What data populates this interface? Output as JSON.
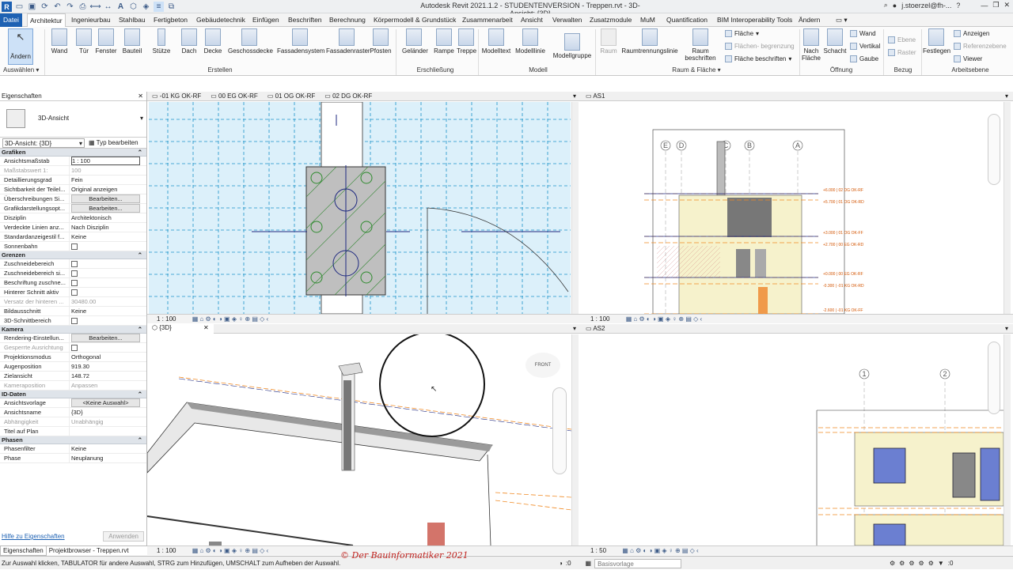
{
  "titlebar": {
    "title": "Autodesk Revit 2021.1.2 - STUDENTENVERSION - Treppen.rvt - 3D-Ansicht: {3D}",
    "user": "j.stoerzel@fh-..."
  },
  "menu": {
    "tabs": [
      "Datei",
      "Architektur",
      "Ingenieurbau",
      "Stahlbau",
      "Fertigbeton",
      "Gebäudetechnik",
      "Einfügen",
      "Beschriften",
      "Berechnung",
      "Körpermodell & Grundstück",
      "Zusammenarbeit",
      "Ansicht",
      "Verwalten",
      "Zusatzmodule",
      "MuM",
      "Quantification",
      "BIM Interoperability Tools",
      "Ändern"
    ]
  },
  "ribbon": {
    "modify": "Ändern",
    "select": "Auswählen",
    "build": [
      "Wand",
      "Tür",
      "Fenster",
      "Bauteil",
      "Stütze",
      "Dach",
      "Decke",
      "Geschossdecke",
      "Fassadensystem",
      "Fassadenraster",
      "Pfosten"
    ],
    "build_panel": "Erstellen",
    "circulation": [
      "Geländer",
      "Rampe",
      "Treppe"
    ],
    "circulation_panel": "Erschließung",
    "model": [
      "Modelltext",
      "Modelllinie",
      "Modellgruppe"
    ],
    "model_panel": "Modell",
    "room": [
      "Raum",
      "Raumtrennungslinie",
      "Raum beschriften"
    ],
    "area_small": [
      "Fläche",
      "Flächen- begrenzung",
      "Fläche beschriften"
    ],
    "room_panel": "Raum & Fläche",
    "opening": [
      "Nach Fläche",
      "Schacht"
    ],
    "opening_small": [
      "Wand",
      "Vertikal",
      "Gaube"
    ],
    "opening_panel": "Öffnung",
    "datum_small": [
      "Ebene",
      "Raster"
    ],
    "datum_panel": "Bezug",
    "workplane": "Festlegen",
    "workplane_small": [
      "Anzeigen",
      "Referenzebene",
      "Viewer"
    ],
    "workplane_panel": "Arbeitsebene"
  },
  "properties": {
    "header": "Eigenschaften",
    "type_name": "3D-Ansicht",
    "instance": "3D-Ansicht: {3D}",
    "edit_type": "Typ bearbeiten",
    "groups": [
      {
        "name": "Grafiken",
        "rows": [
          [
            "Ansichtsmaßstab",
            "1 : 100"
          ],
          [
            "Maßstabswert 1:",
            "100"
          ],
          [
            "Detaillierungsgrad",
            "Fein"
          ],
          [
            "Sichtbarkeit der Teilel...",
            "Original anzeigen"
          ],
          [
            "Überschreibungen Si...",
            "Bearbeiten..."
          ],
          [
            "Grafikdarstellungsopt...",
            "Bearbeiten..."
          ],
          [
            "Disziplin",
            "Architektonisch"
          ],
          [
            "Verdeckte Linien anz...",
            "Nach Disziplin"
          ],
          [
            "Standardanzeigestil f...",
            "Keine"
          ],
          [
            "Sonnenbahn",
            ""
          ]
        ]
      },
      {
        "name": "Grenzen",
        "rows": [
          [
            "Zuschneidebereich",
            ""
          ],
          [
            "Zuschneidebereich si...",
            ""
          ],
          [
            "Beschriftung zuschne...",
            ""
          ],
          [
            "Hinterer Schnitt aktiv",
            ""
          ],
          [
            "Versatz der hinteren ...",
            "30480.00"
          ],
          [
            "Bildausschnitt",
            "Keine"
          ],
          [
            "3D-Schnittbereich",
            ""
          ]
        ]
      },
      {
        "name": "Kamera",
        "rows": [
          [
            "Rendering-Einstellun...",
            "Bearbeiten..."
          ],
          [
            "Gesperrte Ausrichtung",
            ""
          ],
          [
            "Projektionsmodus",
            "Orthogonal"
          ],
          [
            "Augenposition",
            "919.30"
          ],
          [
            "Zielansicht",
            "148.72"
          ],
          [
            "Kameraposition",
            "Anpassen"
          ]
        ]
      },
      {
        "name": "ID-Daten",
        "rows": [
          [
            "Ansichtsvorlage",
            "<Keine Auswahl>"
          ],
          [
            "Ansichtsname",
            "{3D}"
          ],
          [
            "Abhängigkeit",
            "Unabhängig"
          ],
          [
            "Titel auf Plan",
            ""
          ]
        ]
      },
      {
        "name": "Phasen",
        "rows": [
          [
            "Phasenfilter",
            "Keine"
          ],
          [
            "Phase",
            "Neuplanung"
          ]
        ]
      }
    ],
    "help": "Hilfe zu Eigenschaften",
    "apply": "Anwenden",
    "tabs": [
      "Eigenschaften",
      "Projektbrowser - Treppen.rvt"
    ]
  },
  "views": {
    "plan_tabs": [
      "-01 KG OK-RF",
      "00 EG OK-RF",
      "01 OG OK-RF",
      "02 DG OK-RF"
    ],
    "plan_scale": "1 : 100",
    "as1_tab": "AS1",
    "as1_scale": "1 : 100",
    "as1_grids": [
      "E",
      "D",
      "C",
      "B",
      "A"
    ],
    "as1_levels": [
      "+6.000 | 02 DG OK-RF",
      "+5.700 | 01 OG OK-RD",
      "+3.000 | 01 OG OK-FF",
      "+2.700 | 00 EG OK-RD",
      "+0.000 | 00 EG OK-RF",
      "-0.300 | -01 KG OK-RD",
      "-2.600 | -01 KG OK-FF"
    ],
    "threeD_tab": "{3D}",
    "threeD_scale": "1 : 100",
    "cube_label": "FRONT",
    "as2_tab": "AS2",
    "as2_scale": "1 : 50",
    "as2_grids": [
      "1",
      "2"
    ]
  },
  "status": {
    "hint": "Zur Auswahl klicken, TABULATOR für andere Auswahl, STRG zum Hinzufügen, UMSCHALT zum Aufheben der Auswahl.",
    "watermark": "© Der Bauinformatiker 2021",
    "zero": ":0",
    "model": "Basisvorlage",
    "filter": ":0"
  }
}
